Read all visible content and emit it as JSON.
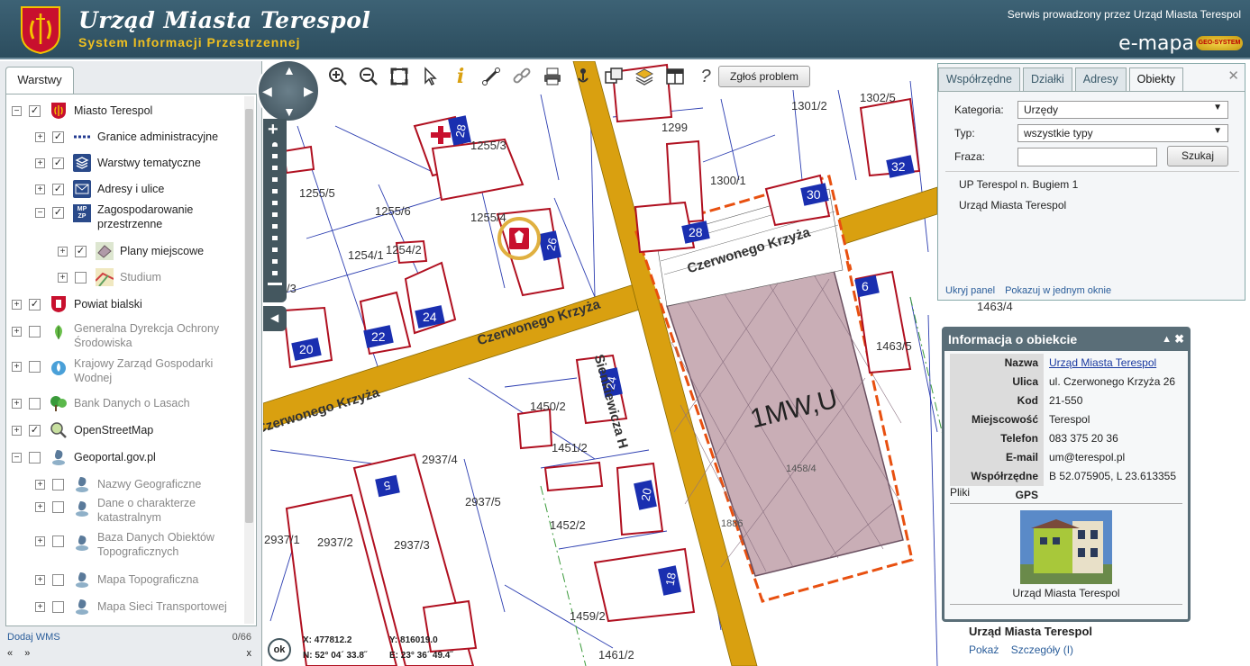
{
  "header": {
    "title": "Urząd Miasta Terespol",
    "subtitle": "System Informacji Przestrzennej",
    "service_note": "Serwis prowadzony przez Urząd Miasta Terespol",
    "brand": "e-mapa",
    "badge": "GEO-SYSTEM"
  },
  "sidebar": {
    "tab": "Warstwy",
    "layers": [
      {
        "label": "Miasto Terespol",
        "expander": "−",
        "checked": true
      },
      {
        "label": "Granice administracyjne",
        "expander": "+",
        "checked": true
      },
      {
        "label": "Warstwy tematyczne",
        "expander": "+",
        "checked": true
      },
      {
        "label": "Adresy i ulice",
        "expander": "+",
        "checked": true
      },
      {
        "label": "Zagospodarowanie",
        "label2": "przestrzenne",
        "expander": "−",
        "checked": true,
        "icon_text": "MP ZP"
      },
      {
        "label": "Plany miejscowe",
        "expander": "+",
        "checked": true
      },
      {
        "label": "Studium",
        "expander": "+",
        "checked": false
      },
      {
        "label": "Powiat bialski",
        "expander": "+",
        "checked": true
      },
      {
        "label": "Generalna Dyrekcja Ochrony",
        "label2": "Środowiska",
        "expander": "+",
        "checked": false
      },
      {
        "label": "Krajowy Zarząd Gospodarki",
        "label2": "Wodnej",
        "expander": "+",
        "checked": false
      },
      {
        "label": "Bank Danych o Lasach",
        "expander": "+",
        "checked": false
      },
      {
        "label": "OpenStreetMap",
        "expander": "+",
        "checked": true
      },
      {
        "label": "Geoportal.gov.pl",
        "expander": "−",
        "checked": false
      },
      {
        "label": "Nazwy Geograficzne",
        "expander": "+",
        "checked": false
      },
      {
        "label": "Dane o charakterze",
        "label2": "katastralnym",
        "expander": "+",
        "checked": false
      },
      {
        "label": "Baza Danych Obiektów",
        "label2": "Topograficznych",
        "expander": "+",
        "checked": false
      },
      {
        "label": "Mapa Topograficzna",
        "expander": "+",
        "checked": false
      },
      {
        "label": "Mapa Sieci Transportowej",
        "expander": "+",
        "checked": false
      }
    ],
    "add_wms": "Dodaj WMS",
    "count": "0/66",
    "nav_prev": "«",
    "nav_next": "»",
    "close": "x"
  },
  "toolbar": {
    "report_problem": "Zgłoś problem",
    "help": "?"
  },
  "search_panel": {
    "tabs": [
      "Współrzędne",
      "Działki",
      "Adresy",
      "Obiekty"
    ],
    "active_tab": "Obiekty",
    "category_label": "Kategoria:",
    "category_value": "Urzędy",
    "type_label": "Typ:",
    "type_value": "wszystkie typy",
    "phrase_label": "Fraza:",
    "phrase_value": "",
    "search_button": "Szukaj",
    "results": [
      "UP Terespol n. Bugiem 1",
      "Urząd Miasta Terespol"
    ],
    "hide_panel": "Ukryj panel",
    "show_in_window": "Pokazuj w jednym oknie"
  },
  "info_panel": {
    "title": "Informacja o obiekcie",
    "rows": [
      {
        "key": "Nazwa",
        "value": "Urząd Miasta Terespol"
      },
      {
        "key": "Ulica",
        "value": "ul. Czerwonego Krzyża 26"
      },
      {
        "key": "Kod",
        "value": "21-550"
      },
      {
        "key": "Miejscowość",
        "value": "Terespol"
      },
      {
        "key": "Telefon",
        "value": "083 375 20 36"
      },
      {
        "key": "E-mail",
        "value": "um@terespol.pl"
      },
      {
        "key": "Współrzędne GPS",
        "value": "B 52.075905, L 23.613355"
      }
    ],
    "files_label": "Pliki",
    "photo_caption": "Urząd Miasta Terespol"
  },
  "result_box": {
    "title": "Urząd Miasta Terespol",
    "show": "Pokaż",
    "details": "Szczegóły (I)"
  },
  "coords": {
    "ok": "ok",
    "x": "X: 477812.2",
    "y": "Y: 816019.0",
    "n": "N: 52° 04´ 33.8˝",
    "e": "E: 23° 36´ 49.4˝"
  },
  "map": {
    "street": "Czerwonego Krzyża",
    "street2": "Sienkiewicza H",
    "zone": "1MW,U",
    "parcels": [
      "1255/3",
      "1255/5",
      "1255/6",
      "1255/4",
      "1254/1",
      "1254/2",
      "1299",
      "1301/2",
      "1302/5",
      "1300/1",
      "1463/4",
      "1463/5",
      "1450/2",
      "1451/2",
      "1452/2",
      "2937/4",
      "2937/5",
      "2937/2",
      "2937/3",
      "1459/2",
      "1461/2",
      "1458/4",
      "1886",
      "2937/1",
      "/3"
    ],
    "house_numbers": [
      "28",
      "26",
      "24",
      "22",
      "20",
      "30",
      "28",
      "32",
      "6",
      "24",
      "5",
      "20",
      "18"
    ],
    "colors": {
      "road": "#d9a010",
      "building": "#b01020",
      "number_box": "#1a2fb0",
      "parcel_line": "#2a3cb0",
      "zone_fill": "#c9aeb6",
      "zone_border": "#e85010"
    }
  }
}
